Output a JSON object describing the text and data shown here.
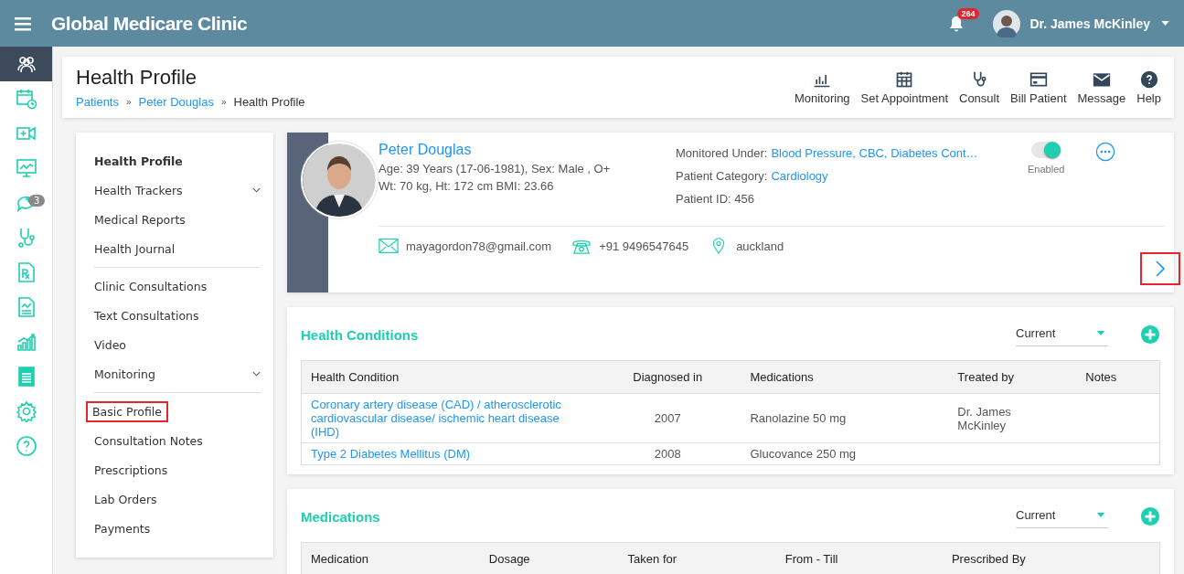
{
  "topbar": {
    "title": "Global Medicare Clinic",
    "notifications": "264",
    "user": "Dr. James McKinley"
  },
  "rail": [
    {
      "kind": "patients",
      "selected": true
    },
    {
      "kind": "calendar",
      "selected": false
    },
    {
      "kind": "video",
      "selected": false
    },
    {
      "kind": "monitor",
      "selected": false
    },
    {
      "kind": "chat",
      "selected": false,
      "badge": "3"
    },
    {
      "kind": "stethoscope",
      "selected": false
    },
    {
      "kind": "rx",
      "selected": false
    },
    {
      "kind": "report",
      "selected": false
    },
    {
      "kind": "growth",
      "selected": false
    },
    {
      "kind": "sheet",
      "selected": false
    },
    {
      "kind": "settings",
      "selected": false
    },
    {
      "kind": "help",
      "selected": false
    }
  ],
  "header": {
    "title": "Health Profile",
    "breadcrumb": [
      {
        "label": "Patients",
        "link": true,
        "separator": "»"
      },
      {
        "label": "Peter Douglas",
        "link": true,
        "separator": "»"
      },
      {
        "label": "Health Profile",
        "link": false
      }
    ],
    "actions": [
      {
        "kind": "chart",
        "label": "Monitoring"
      },
      {
        "kind": "calendar",
        "label": "Set Appointment"
      },
      {
        "kind": "stethoscope",
        "label": "Consult"
      },
      {
        "kind": "card",
        "label": "Bill Patient"
      },
      {
        "kind": "mail",
        "label": "Message"
      },
      {
        "kind": "help",
        "label": "Help"
      }
    ]
  },
  "sidebar": {
    "groups": [
      [
        {
          "label": "Health Profile",
          "selected": true,
          "expandable": false,
          "highlighted": false
        },
        {
          "label": "Health Trackers",
          "selected": false,
          "expandable": true,
          "highlighted": false
        },
        {
          "label": "Medical Reports",
          "selected": false,
          "expandable": false,
          "highlighted": false
        },
        {
          "label": "Health Journal",
          "selected": false,
          "expandable": false,
          "highlighted": false
        }
      ],
      [
        {
          "label": "Clinic Consultations",
          "selected": false,
          "expandable": false,
          "highlighted": false
        },
        {
          "label": "Text Consultations",
          "selected": false,
          "expandable": false,
          "highlighted": false
        },
        {
          "label": "Video",
          "selected": false,
          "expandable": false,
          "highlighted": false
        },
        {
          "label": "Monitoring",
          "selected": false,
          "expandable": true,
          "highlighted": false
        }
      ],
      [
        {
          "label": "Basic Profile",
          "selected": false,
          "expandable": false,
          "highlighted": true
        },
        {
          "label": "Consultation Notes",
          "selected": false,
          "expandable": false,
          "highlighted": false
        },
        {
          "label": "Prescriptions",
          "selected": false,
          "expandable": false,
          "highlighted": false
        },
        {
          "label": "Lab Orders",
          "selected": false,
          "expandable": false,
          "highlighted": false
        },
        {
          "label": "Payments",
          "selected": false,
          "expandable": false,
          "highlighted": false
        }
      ]
    ]
  },
  "patient": {
    "name": "Peter Douglas",
    "age_line": "Age: 39 Years (17-06-1981), Sex: Male , O+",
    "body_line": "Wt: 70 kg, Ht: 172 cm BMI: 23.66",
    "facts": [
      {
        "label": "Monitored Under:",
        "value": "Blood Pressure, CBC, Diabetes Cont…"
      },
      {
        "label": "Patient Category:",
        "value": "Cardiology"
      },
      {
        "label": "Patient ID: 456"
      }
    ],
    "toggle": {
      "on": true,
      "label": "Enabled"
    },
    "contacts": [
      {
        "kind": "email",
        "text": "mayagordon78@gmail.com"
      },
      {
        "kind": "phone",
        "text": "+91 9496547645"
      },
      {
        "kind": "location",
        "text": "auckland"
      }
    ],
    "next_highlighted": true
  },
  "health_conditions": {
    "title": "Health Conditions",
    "filter": "Current",
    "columns": [
      "Health Condition",
      "Diagnosed in",
      "Medications",
      "Treated by",
      "Notes"
    ],
    "rows": [
      [
        "Coronary artery disease (CAD) / atherosclerotic cardiovascular disease/ ischemic heart disease (IHD)",
        "2007",
        "Ranolazine 50 mg",
        "Dr. James McKinley",
        ""
      ],
      [
        "Type 2 Diabetes Mellitus (DM)",
        "2008",
        "Glucovance 250 mg",
        "",
        ""
      ]
    ]
  },
  "medications": {
    "title": "Medications",
    "filter": "Current",
    "columns": [
      "Medication",
      "Dosage",
      "Taken for",
      "From - Till",
      "Prescribed By"
    ]
  }
}
